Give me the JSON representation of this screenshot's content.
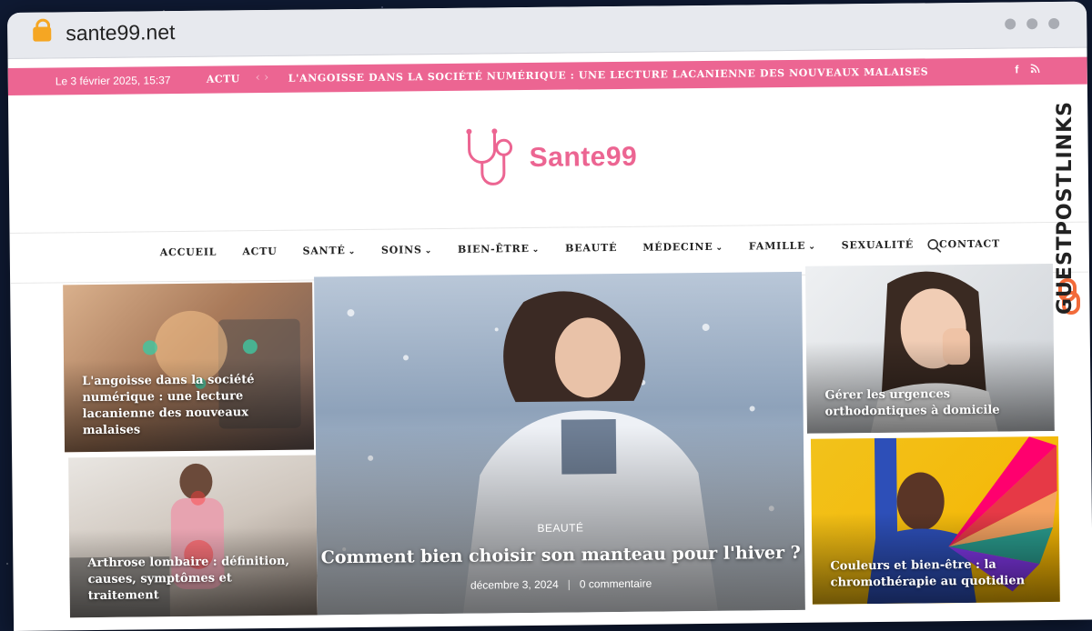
{
  "browser": {
    "url": "sante99.net"
  },
  "topbar": {
    "date": "Le 3 février 2025, 15:37",
    "category": "ACTU",
    "ticker": "L'ANGOISSE DANS LA SOCIÉTÉ NUMÉRIQUE : UNE LECTURE LACANIENNE DES NOUVEAUX MALAISES",
    "social": [
      "f",
      "rss"
    ]
  },
  "logo": {
    "text": "Sante99",
    "icon": "stethoscope-icon",
    "color": "#ec6592"
  },
  "nav": {
    "items": [
      {
        "label": "ACCUEIL",
        "dropdown": false
      },
      {
        "label": "ACTU",
        "dropdown": false
      },
      {
        "label": "SANTÉ",
        "dropdown": true
      },
      {
        "label": "SOINS",
        "dropdown": true
      },
      {
        "label": "BIEN-ÊTRE",
        "dropdown": true
      },
      {
        "label": "BEAUTÉ",
        "dropdown": false
      },
      {
        "label": "MÉDECINE",
        "dropdown": true
      },
      {
        "label": "FAMILLE",
        "dropdown": true
      },
      {
        "label": "SEXUALITÉ",
        "dropdown": false
      },
      {
        "label": "CONTACT",
        "dropdown": false
      }
    ]
  },
  "articles": {
    "left_top": "L'angoisse dans la société numérique : une lecture lacanienne des nouveaux malaises",
    "left_bottom": "Arthrose lombaire : définition, causes, symptômes et traitement",
    "featured": {
      "category": "BEAUTÉ",
      "title": "Comment bien choisir son manteau pour l'hiver ?",
      "date": "décembre 3, 2024",
      "comments": "0 commentaire"
    },
    "right_top": "Gérer les urgences orthodontiques à domicile",
    "right_bottom": "Couleurs et bien-être : la chromothérapie au quotidien"
  },
  "watermark": {
    "text": "GUESTPOSTLINKS"
  },
  "colors": {
    "accent": "#ec6592",
    "watermark_accent": "#f26b3a"
  }
}
